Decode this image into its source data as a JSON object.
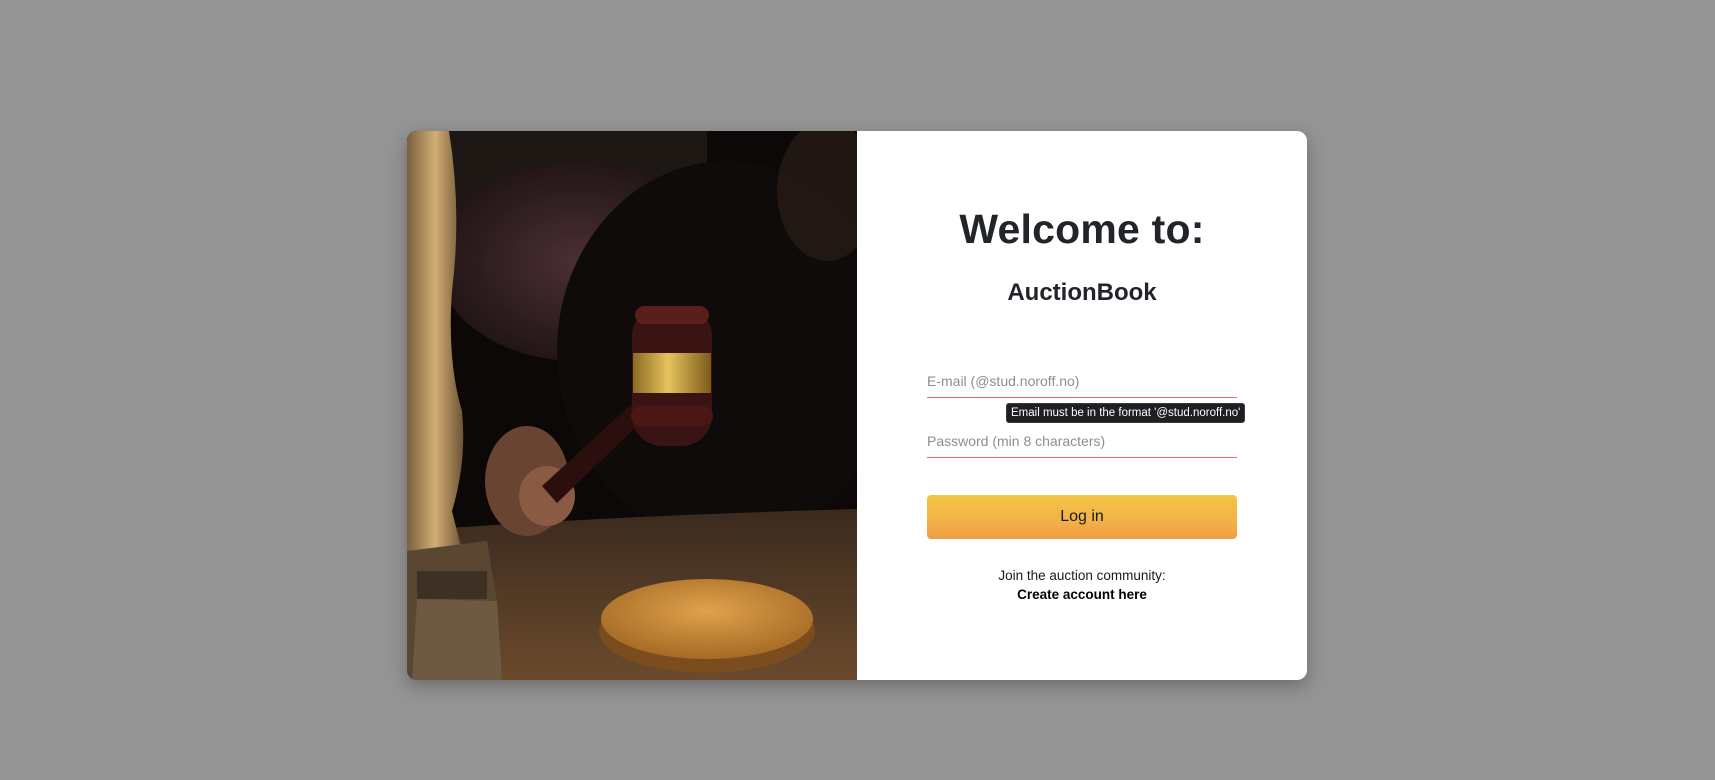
{
  "hero_image": {
    "icon": "gavel-courtroom-photo"
  },
  "login": {
    "heading": "Welcome to:",
    "app_name": "AuctionBook",
    "email_placeholder": "E-mail (@stud.noroff.no)",
    "email_value": "",
    "email_validation_tooltip": "Email must be in the format '@stud.noroff.no'",
    "password_placeholder": "Password (min 8 characters)",
    "password_value": "",
    "submit_label": "Log in",
    "join_text": "Join the auction community:",
    "create_account_label": "Create account here"
  },
  "colors": {
    "backdrop": "#949494",
    "field_underline_invalid": "#f0646a",
    "button_gradient_top": "#f4c545",
    "button_gradient_bottom": "#ee9e45"
  }
}
